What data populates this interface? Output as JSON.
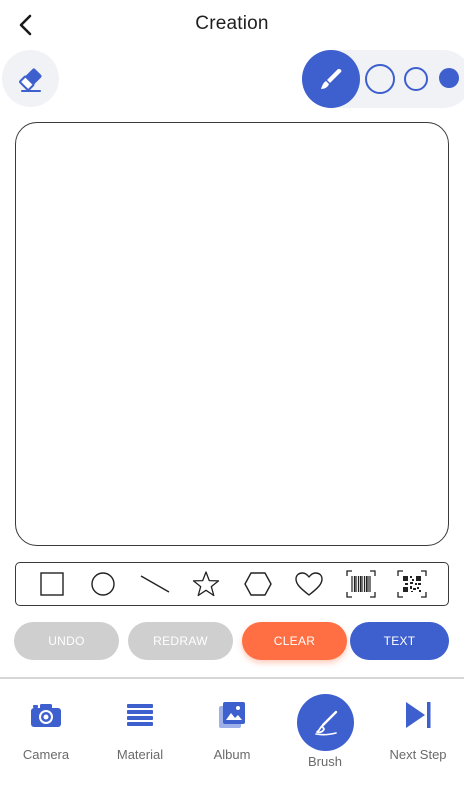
{
  "header": {
    "title": "Creation"
  },
  "toolbar": {
    "eraser_icon": "eraser-icon",
    "brush_icon": "brush-icon",
    "active_brush_size": "large"
  },
  "shapes": [
    {
      "name": "square",
      "icon": "square-icon"
    },
    {
      "name": "circle",
      "icon": "circle-icon"
    },
    {
      "name": "line",
      "icon": "line-icon"
    },
    {
      "name": "star",
      "icon": "star-icon"
    },
    {
      "name": "hexagon",
      "icon": "hexagon-icon"
    },
    {
      "name": "heart",
      "icon": "heart-icon"
    },
    {
      "name": "barcode",
      "icon": "barcode-icon"
    },
    {
      "name": "qrcode",
      "icon": "qr-code-icon"
    }
  ],
  "actions": {
    "undo": "UNDO",
    "redraw": "REDRAW",
    "clear": "CLEAR",
    "text": "TEXT"
  },
  "bottom_nav": {
    "camera": "Camera",
    "material": "Material",
    "album": "Album",
    "brush": "Brush",
    "next_step": "Next Step",
    "active": "Brush"
  },
  "colors": {
    "accent": "#3e5fce",
    "clear": "#ff6f43",
    "disabled": "#cfcfcf",
    "nav_label": "#6a6a6a"
  }
}
